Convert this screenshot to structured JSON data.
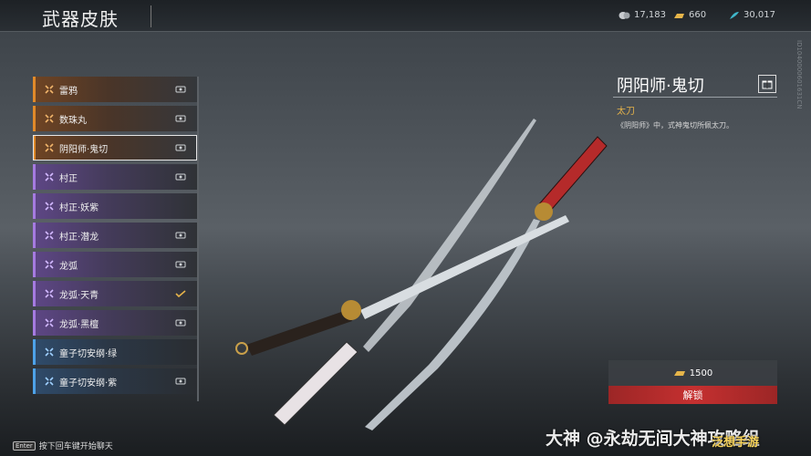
{
  "header": {
    "title": "武器皮肤"
  },
  "currencies": [
    {
      "icon": "coin-icon",
      "value": "17,183",
      "color": "#c9ccd0"
    },
    {
      "icon": "gold-bar-icon",
      "value": "660",
      "color": "#e6b54a"
    },
    {
      "icon": "feather-icon",
      "value": "30,017",
      "color": "#3fb6c9"
    }
  ],
  "skins": [
    {
      "label": "雷鸦",
      "rarity": "orange",
      "eye": true,
      "selected": false,
      "check": false
    },
    {
      "label": "数珠丸",
      "rarity": "orange",
      "eye": true,
      "selected": false,
      "check": false
    },
    {
      "label": "阴阳师·鬼切",
      "rarity": "orange",
      "eye": true,
      "selected": true,
      "check": false
    },
    {
      "label": "村正",
      "rarity": "purple",
      "eye": true,
      "selected": false,
      "check": false
    },
    {
      "label": "村正·妖紫",
      "rarity": "purple",
      "eye": false,
      "selected": false,
      "check": false
    },
    {
      "label": "村正·潜龙",
      "rarity": "purple",
      "eye": true,
      "selected": false,
      "check": false
    },
    {
      "label": "龙弧",
      "rarity": "purple",
      "eye": true,
      "selected": false,
      "check": false
    },
    {
      "label": "龙弧·天青",
      "rarity": "purple",
      "eye": false,
      "selected": false,
      "check": true
    },
    {
      "label": "龙弧·黑檀",
      "rarity": "purple",
      "eye": true,
      "selected": false,
      "check": false
    },
    {
      "label": "童子切安纲·绿",
      "rarity": "blue",
      "eye": false,
      "selected": false,
      "check": false
    },
    {
      "label": "童子切安纲·紫",
      "rarity": "blue",
      "eye": true,
      "selected": false,
      "check": false
    }
  ],
  "detail": {
    "title": "阴阳师·鬼切",
    "type": "太刀",
    "description": "《阴阳师》中，式神鬼切所佩太刀。",
    "id_text": "ID1040000601631CN",
    "price": "1500",
    "unlock_label": "解锁"
  },
  "footer": {
    "key": "Enter",
    "hint": "按下回车键开始聊天"
  },
  "watermark": {
    "logo": "大神",
    "handle": "@永劫无间大神攻略组",
    "corner": "泛想手游"
  },
  "colors": {
    "unlock": "#c53030",
    "accent_gold": "#e6b34a"
  }
}
